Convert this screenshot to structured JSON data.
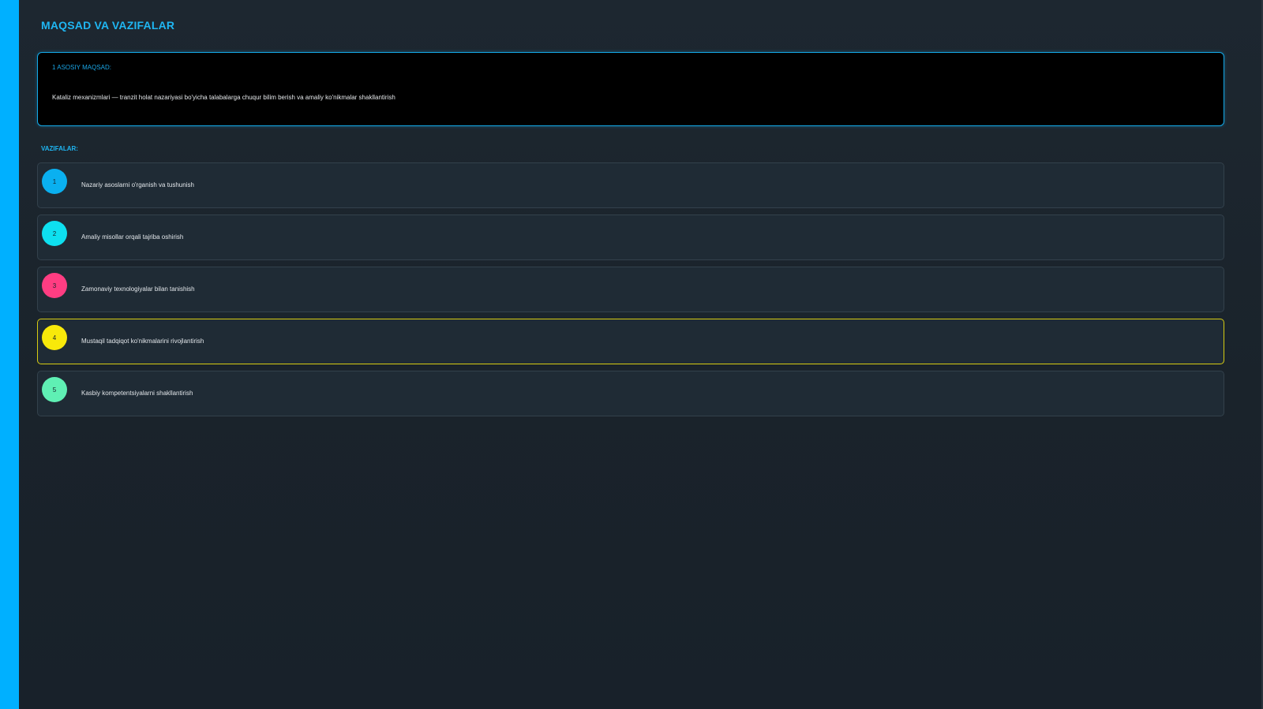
{
  "page": {
    "title": "MAQSAD VA VAZIFALAR"
  },
  "goal": {
    "label": "1 ASOSIY MAQSAD:",
    "text": "Kataliz mexanizmlari — tranzit holat nazariyasi bo'yicha talabalarga chuqur bilim berish va amaliy ko'nikmalar shakllantirish"
  },
  "tasks": {
    "heading": "VAZIFALAR:",
    "items": [
      {
        "number": "1",
        "text": "Nazariy asoslarni o'rganish va tushunish",
        "color": "#0ab0f0"
      },
      {
        "number": "2",
        "text": "Amaliy misollar orqali tajriba oshirish",
        "color": "#0ee0f0"
      },
      {
        "number": "3",
        "text": "Zamonaviy texnologiyalar bilan tanishish",
        "color": "#ff3d82"
      },
      {
        "number": "4",
        "text": "Mustaqil tadqiqot ko'nikmalarini rivojlantirish",
        "color": "#f8e90a"
      },
      {
        "number": "5",
        "text": "Kasbiy kompetentsiyalarni shakllantirish",
        "color": "#5ff0b4"
      }
    ]
  },
  "colors": {
    "accent": "#00b0ff",
    "highlight_border": "#d7cc12",
    "background": "#1a222a",
    "card": "#1f2b35"
  }
}
